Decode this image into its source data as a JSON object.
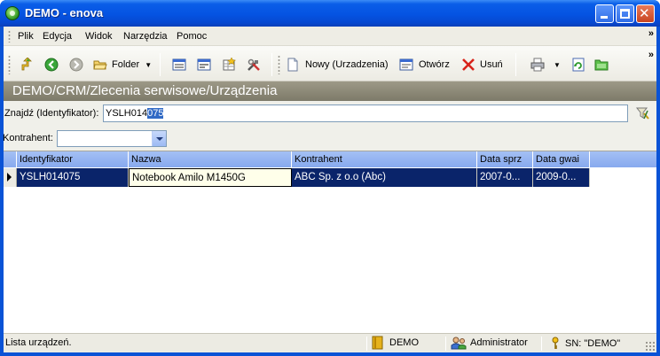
{
  "window": {
    "title": "DEMO - enova"
  },
  "menu": {
    "items": [
      {
        "label": "Plik"
      },
      {
        "label": "Edycja"
      },
      {
        "label": "Widok"
      },
      {
        "label": "Narzędzia"
      },
      {
        "label": "Pomoc"
      }
    ],
    "overflow": "»"
  },
  "toolbar": {
    "folder_label": "Folder",
    "new_label": "Nowy (Urzadzenia)",
    "open_label": "Otwórz",
    "delete_label": "Usuń",
    "overflow": "»"
  },
  "breadcrumb": {
    "path": "DEMO/CRM/Zlecenia serwisowe/Urządzenia"
  },
  "filters": {
    "search_label": "Znajdź (Identyfikator):",
    "search_value_plain": "YSLH014",
    "search_value_selected": "075",
    "contractor_label": "Kontrahent:",
    "contractor_value": ""
  },
  "grid": {
    "columns": [
      "Identyfikator",
      "Nazwa",
      "Kontrahent",
      "Data sprzedaży",
      "Data gwarancji"
    ],
    "columns_display": [
      "Identyfikator",
      "Nazwa",
      "Kontrahent",
      "Data sprz",
      "Data gwai"
    ],
    "rows": [
      {
        "identyfikator": "YSLH014075",
        "nazwa": "Notebook Amilo M1450G",
        "kontrahent": "ABC Sp. z o.o (Abc)",
        "data_sprzedazy": "2007-0...",
        "data_gwarancji": "2009-0..."
      }
    ]
  },
  "status": {
    "text": "Lista urządzeń.",
    "database": "DEMO",
    "user": "Administrator",
    "serial": "SN: \"DEMO\""
  },
  "colors": {
    "titlebar": "#0553e2",
    "selection": "#0a246a",
    "grid_header": "#a4c0f4",
    "path_band": "#8c8977"
  }
}
